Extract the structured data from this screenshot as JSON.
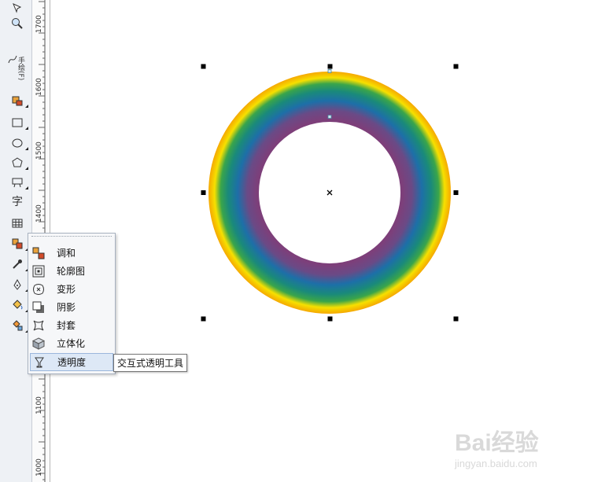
{
  "toolbox": {
    "freehand_label": "手绘(F)",
    "text_tool": "字"
  },
  "ruler": {
    "ticks": [
      "1700",
      "1600",
      "1500",
      "1400",
      "1100",
      "1000"
    ]
  },
  "flyout": {
    "items": [
      {
        "label": "调和",
        "icon": "blend-icon"
      },
      {
        "label": "轮廓图",
        "icon": "contour-icon"
      },
      {
        "label": "变形",
        "icon": "distort-icon"
      },
      {
        "label": "阴影",
        "icon": "shadow-icon"
      },
      {
        "label": "封套",
        "icon": "envelope-icon"
      },
      {
        "label": "立体化",
        "icon": "extrude-icon"
      },
      {
        "label": "透明度",
        "icon": "transparency-icon",
        "active": true
      }
    ]
  },
  "tooltip": {
    "text": "交互式透明工具"
  },
  "watermark": {
    "brand": "Bai经验",
    "url": "jingyan.baidu.com"
  },
  "colors": {
    "ring_outer": "#f5a800",
    "ring_yellow": "#f7e000",
    "ring_green": "#3aa54a",
    "ring_teal": "#1a8a7a",
    "ring_blue": "#1d6fa8",
    "ring_purple": "#7d3f7a"
  }
}
